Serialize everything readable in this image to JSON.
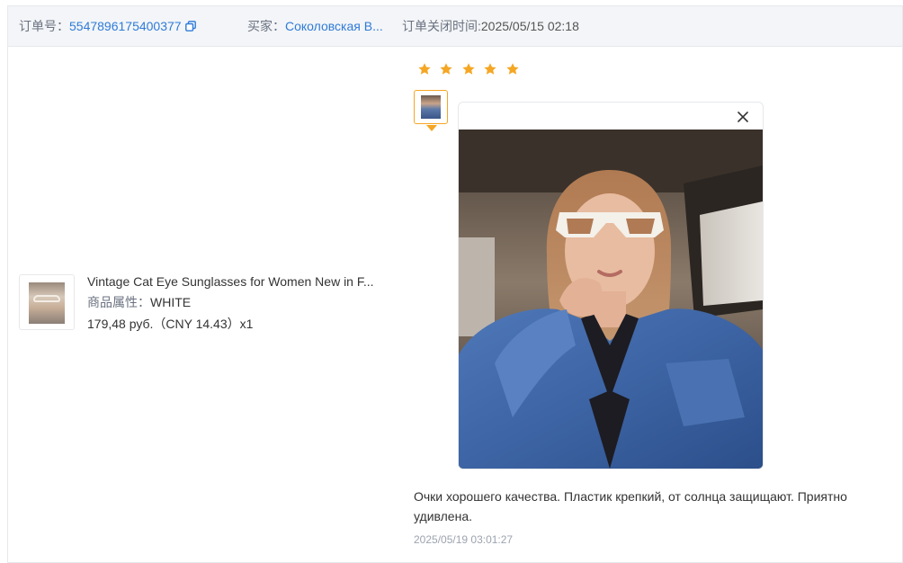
{
  "order": {
    "number_label": "订单号：",
    "number": "5547896175400377",
    "buyer_label": "买家：",
    "buyer_name": "Соколовская В...",
    "closed_label": "订单关闭时间:",
    "closed_time": "2025/05/15 02:18",
    "copy_icon": "copy-icon"
  },
  "product": {
    "title": "Vintage Cat Eye Sunglasses for Women New in F...",
    "attr_label": "商品属性：",
    "attr_value": "WHITE",
    "price": "179,48 руб.（CNY  14.43）x1"
  },
  "review": {
    "rating": 5,
    "rating_max": 5,
    "star_color": "#f5a623",
    "text": "Очки хорошего качества. Пластик крепкий, от солнца защищают. Приятно удивлена.",
    "time": "2025/05/19 03:01:27",
    "close_icon": "close-icon"
  },
  "colors": {
    "link": "#2f7bd8",
    "header_bg": "#f3f5f8",
    "accent": "#f5a623"
  }
}
